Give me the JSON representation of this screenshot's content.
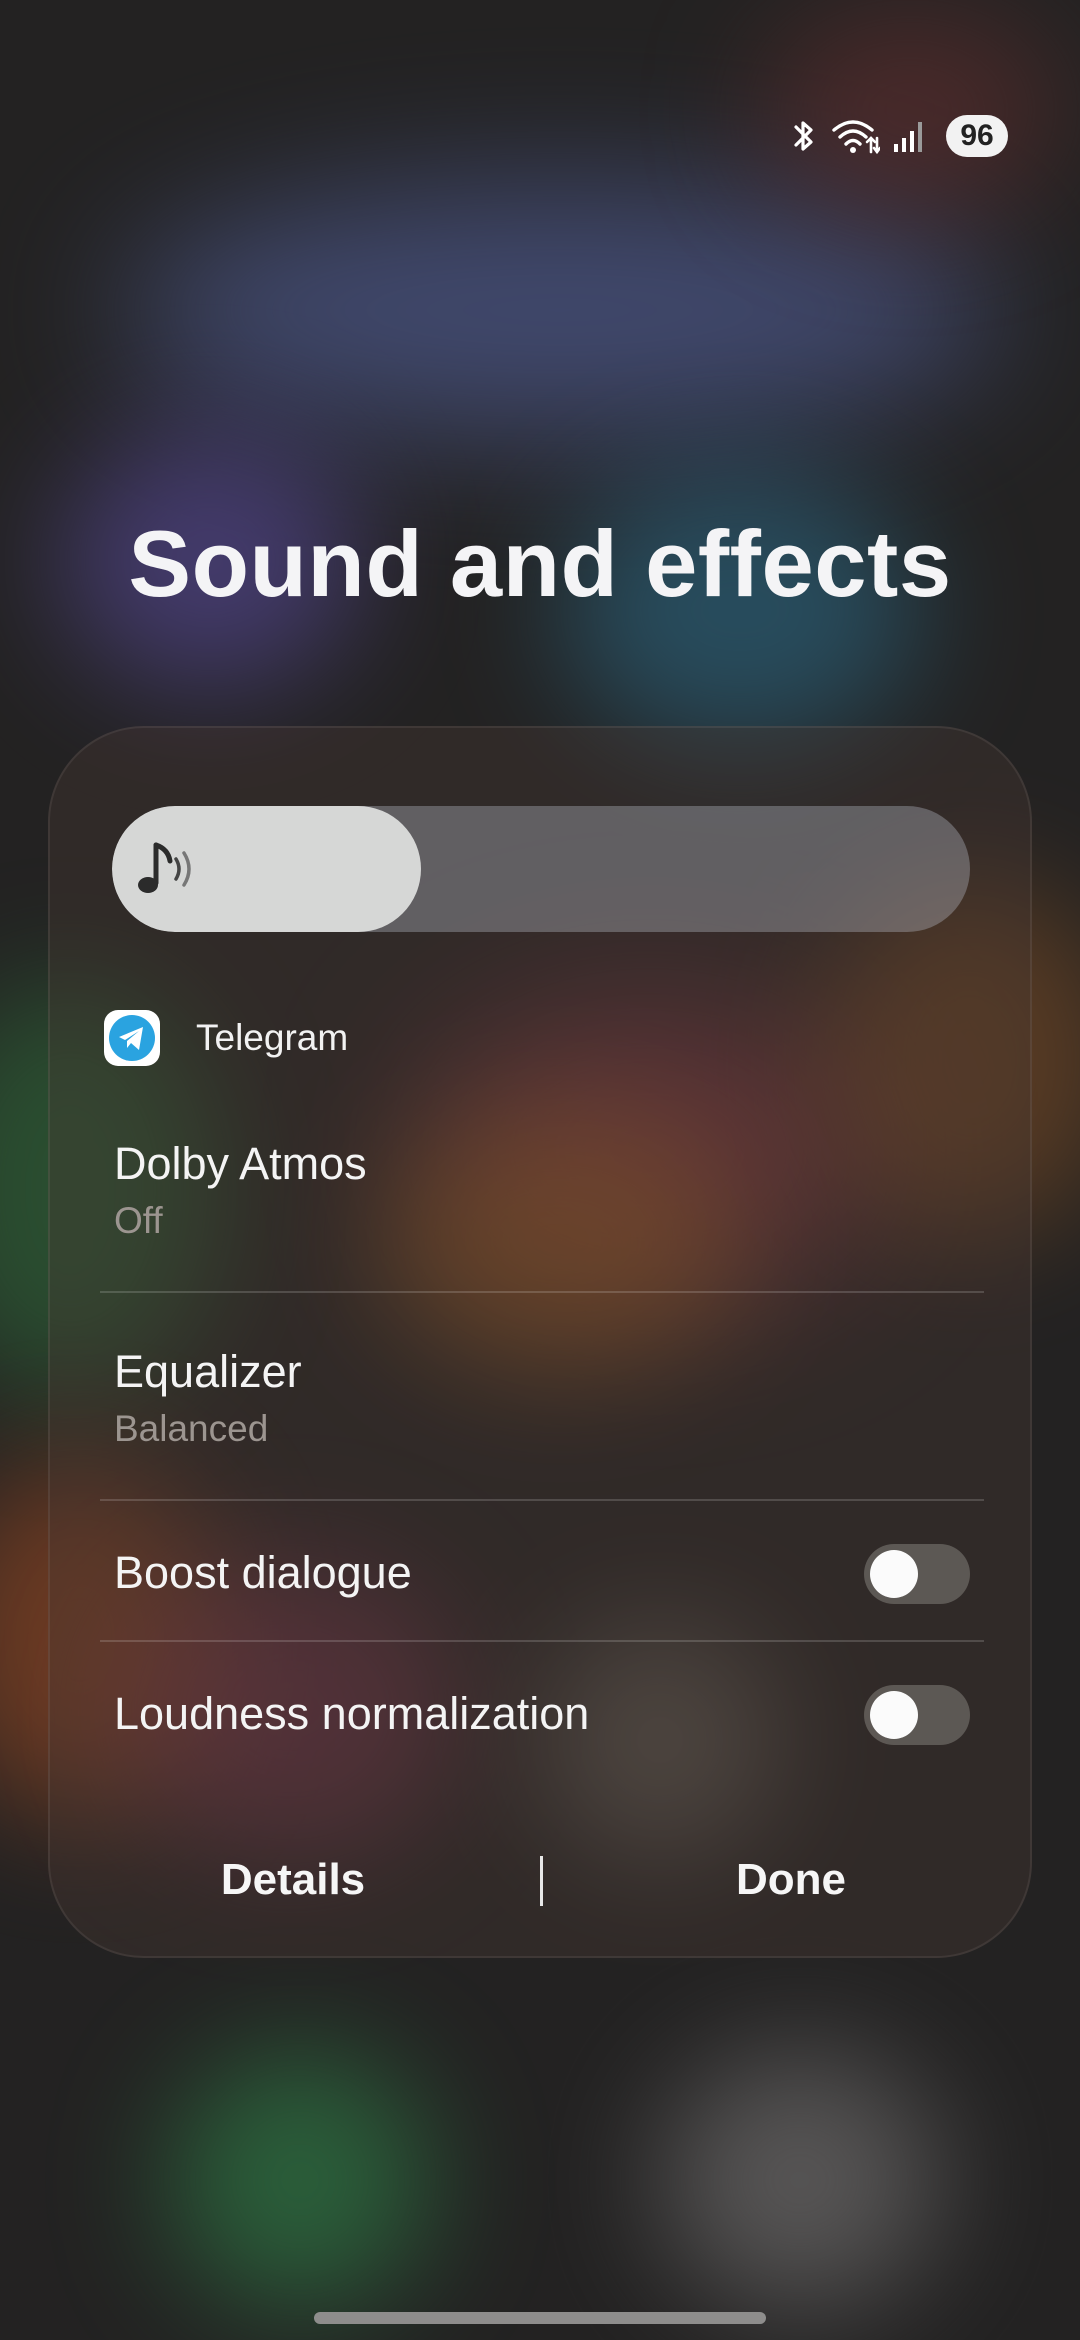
{
  "status_bar": {
    "icons": [
      "bluetooth-icon",
      "wifi-icon",
      "signal-icon"
    ],
    "battery": "96"
  },
  "title": "Sound and effects",
  "volume_slider": {
    "icon": "music-note-icon",
    "level": 0.36,
    "fill_color": "#d6d7d6"
  },
  "app": {
    "icon": "telegram-icon",
    "name": "Telegram",
    "brand_color": "#2aa3e0"
  },
  "settings": {
    "dolby": {
      "title": "Dolby Atmos",
      "value": "Off"
    },
    "equalizer": {
      "title": "Equalizer",
      "value": "Balanced"
    },
    "boost_dialogue": {
      "title": "Boost dialogue",
      "on": false
    },
    "loudness": {
      "title": "Loudness normalization",
      "on": false
    }
  },
  "buttons": {
    "details": "Details",
    "done": "Done"
  }
}
